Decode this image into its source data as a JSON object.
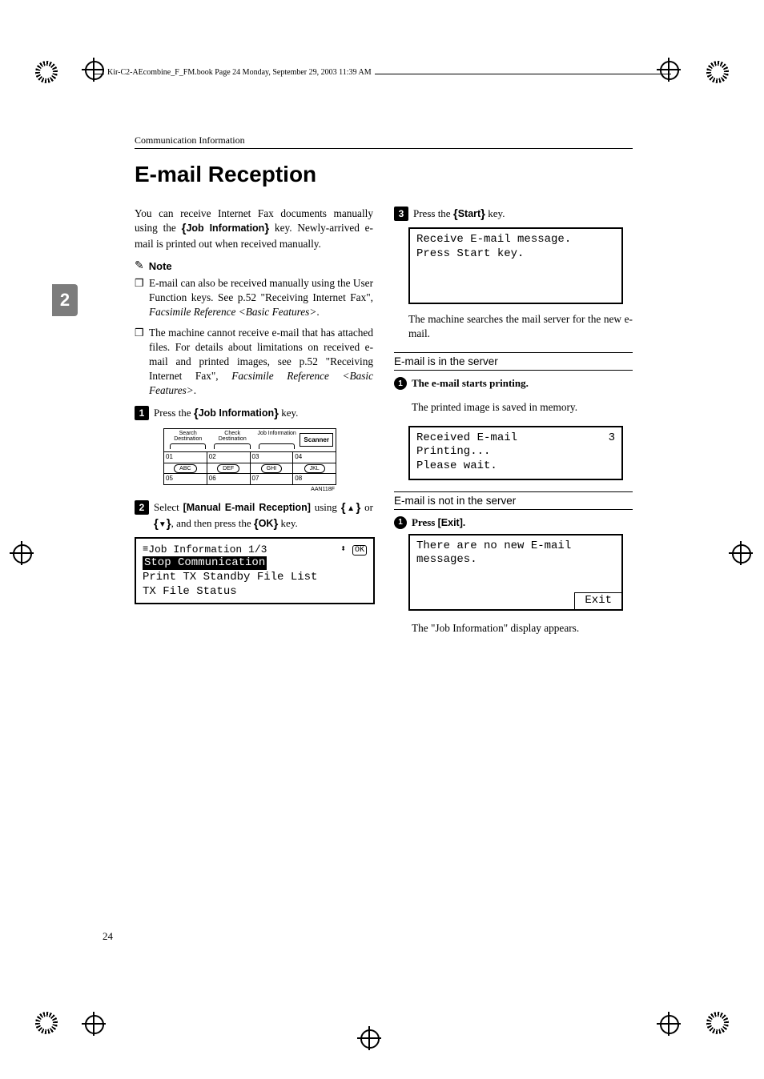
{
  "header": {
    "running": "Kir-C2-AEcombine_F_FM.book  Page 24  Monday, September 29, 2003  11:39 AM"
  },
  "breadcrumb": "Communication Information",
  "sidebar_tab": "2",
  "title": "E-mail Reception",
  "intro": {
    "line1": "You can receive Internet Fax documents manually using the ",
    "key1": "Job Information",
    "line2": " key. Newly-arrived e-mail is printed out when received manually."
  },
  "note": {
    "label": "Note",
    "items": [
      {
        "pre": "E-mail can also be received manually using the User Function keys. See p.52 \"Receiving Internet Fax\", ",
        "ital": "Facsimile Reference <Basic Features>",
        "post": "."
      },
      {
        "pre": "The machine cannot receive e-mail that has attached files. For details about limitations on received e-mail and printed images, see p.52 \"Receiving Internet Fax\", ",
        "ital": "Facsimile Reference <Basic Features>",
        "post": "."
      }
    ]
  },
  "steps": {
    "s1": {
      "n": "1",
      "pre": "Press the ",
      "key": "Job Information",
      "post": " key."
    },
    "s2": {
      "n": "2",
      "pre": "Select ",
      "sel": "[Manual E-mail Reception]",
      "mid": " using ",
      "or": " or ",
      "post": ", and then press the ",
      "okkey": "OK",
      "post2": " key."
    },
    "s3": {
      "n": "3",
      "pre": "Press the ",
      "key": "Start",
      "post": " key."
    }
  },
  "kb": {
    "tabs": [
      "Search\nDestination",
      "Check\nDestination",
      "Job\nInformation"
    ],
    "scanner": "Scanner",
    "row_nums_a": [
      "01",
      "02",
      "03",
      "04"
    ],
    "row_letters": [
      "ABC",
      "DEF",
      "GHI",
      "JKL"
    ],
    "row_nums_b": [
      "05",
      "06",
      "07",
      "08"
    ],
    "caption": "AAN118F"
  },
  "lcd1": {
    "title": "Job Information 1/3",
    "ok": "OK",
    "line_inv": "Stop Communication",
    "line2": "Print TX Standby File List",
    "line3": "TX File Status"
  },
  "lcd2": {
    "line1": "Receive E-mail message.",
    "line2": "Press Start key."
  },
  "after_s3": "The machine searches the mail server for the new e-mail.",
  "section_in": {
    "head": "E-mail is in the server",
    "sub_n": "1",
    "sub_text": "The e-mail starts printing.",
    "sub_body": "The printed image is saved in memory."
  },
  "lcd3": {
    "line1a": "Received E-mail",
    "line1b": "3",
    "line2": "Printing...",
    "line3": "Please wait."
  },
  "section_out": {
    "head": "E-mail is not in the server",
    "sub_n": "1",
    "sub_text_pre": "Press ",
    "sub_text_key": "[Exit]",
    "sub_text_post": "."
  },
  "lcd4": {
    "line1": "There are no new E-mail",
    "line2": "messages.",
    "exit": "Exit"
  },
  "after_lcd4": "The \"Job Information\" display appears.",
  "page_num": "24"
}
